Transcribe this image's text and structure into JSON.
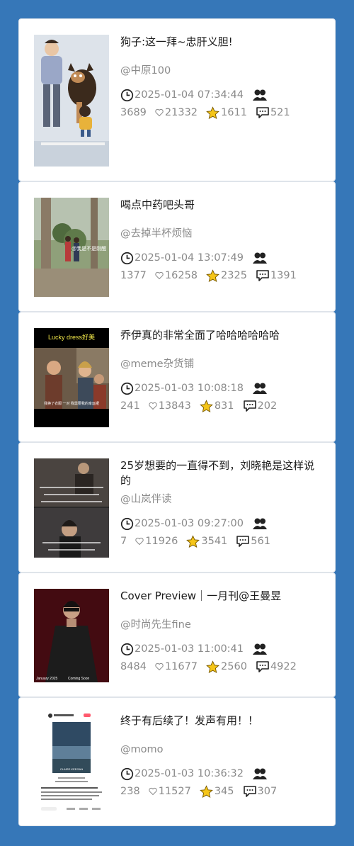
{
  "feed": [
    {
      "title": "狗子:这一拜~忠肝义胆!",
      "author": "@中原100",
      "datetime": "2025-01-04 07:34:44",
      "views": "3689",
      "likes": "21332",
      "stars": "1611",
      "comments": "521",
      "thumb_label": ""
    },
    {
      "title": "喝点中药吧头哥",
      "author": "@去掉半杯烦恼",
      "datetime": "2025-01-04 13:07:49",
      "views": "1377",
      "likes": "16258",
      "stars": "2325",
      "comments": "1391",
      "thumb_label": "@我是不是刚醒"
    },
    {
      "title": "乔伊真的非常全面了哈哈哈哈哈哈",
      "author": "@meme杂货铺",
      "datetime": "2025-01-03 10:08:18",
      "views": "241",
      "likes": "13843",
      "stars": "831",
      "comments": "202",
      "thumb_label": "Lucky dress好美",
      "thumb_sub": "我换了衣服 一对   我需要我的幸运裙"
    },
    {
      "title": "25岁想要的一直得不到，刘晓艳是这样说的",
      "author": "@山岚伴读",
      "datetime": "2025-01-03 09:27:00",
      "views": "7",
      "likes": "11926",
      "stars": "3541",
      "comments": "561",
      "thumb_label": ""
    },
    {
      "title": "Cover Preview｜一月刊@王曼昱",
      "author": "@时尚先生fine",
      "datetime": "2025-01-03 11:00:41",
      "views": "8484",
      "likes": "11677",
      "stars": "2560",
      "comments": "4922",
      "thumb_label": "January 2025",
      "thumb_sub": "Coming Soon"
    },
    {
      "title": "终于有后续了！发声有用！！",
      "author": "@momo",
      "datetime": "2025-01-03 10:36:32",
      "views": "238",
      "likes": "11527",
      "stars": "345",
      "comments": "307",
      "thumb_label": "CLAIRE KEEGAN"
    }
  ],
  "icons": {
    "time": "clock-icon",
    "views": "users-icon",
    "likes": "heart-icon",
    "stars": "star-icon",
    "comments": "comment-icon"
  },
  "colors": {
    "background": "#3677b8",
    "card": "#ffffff",
    "star": "#f5c518",
    "meta_text": "#8a8a8a"
  }
}
